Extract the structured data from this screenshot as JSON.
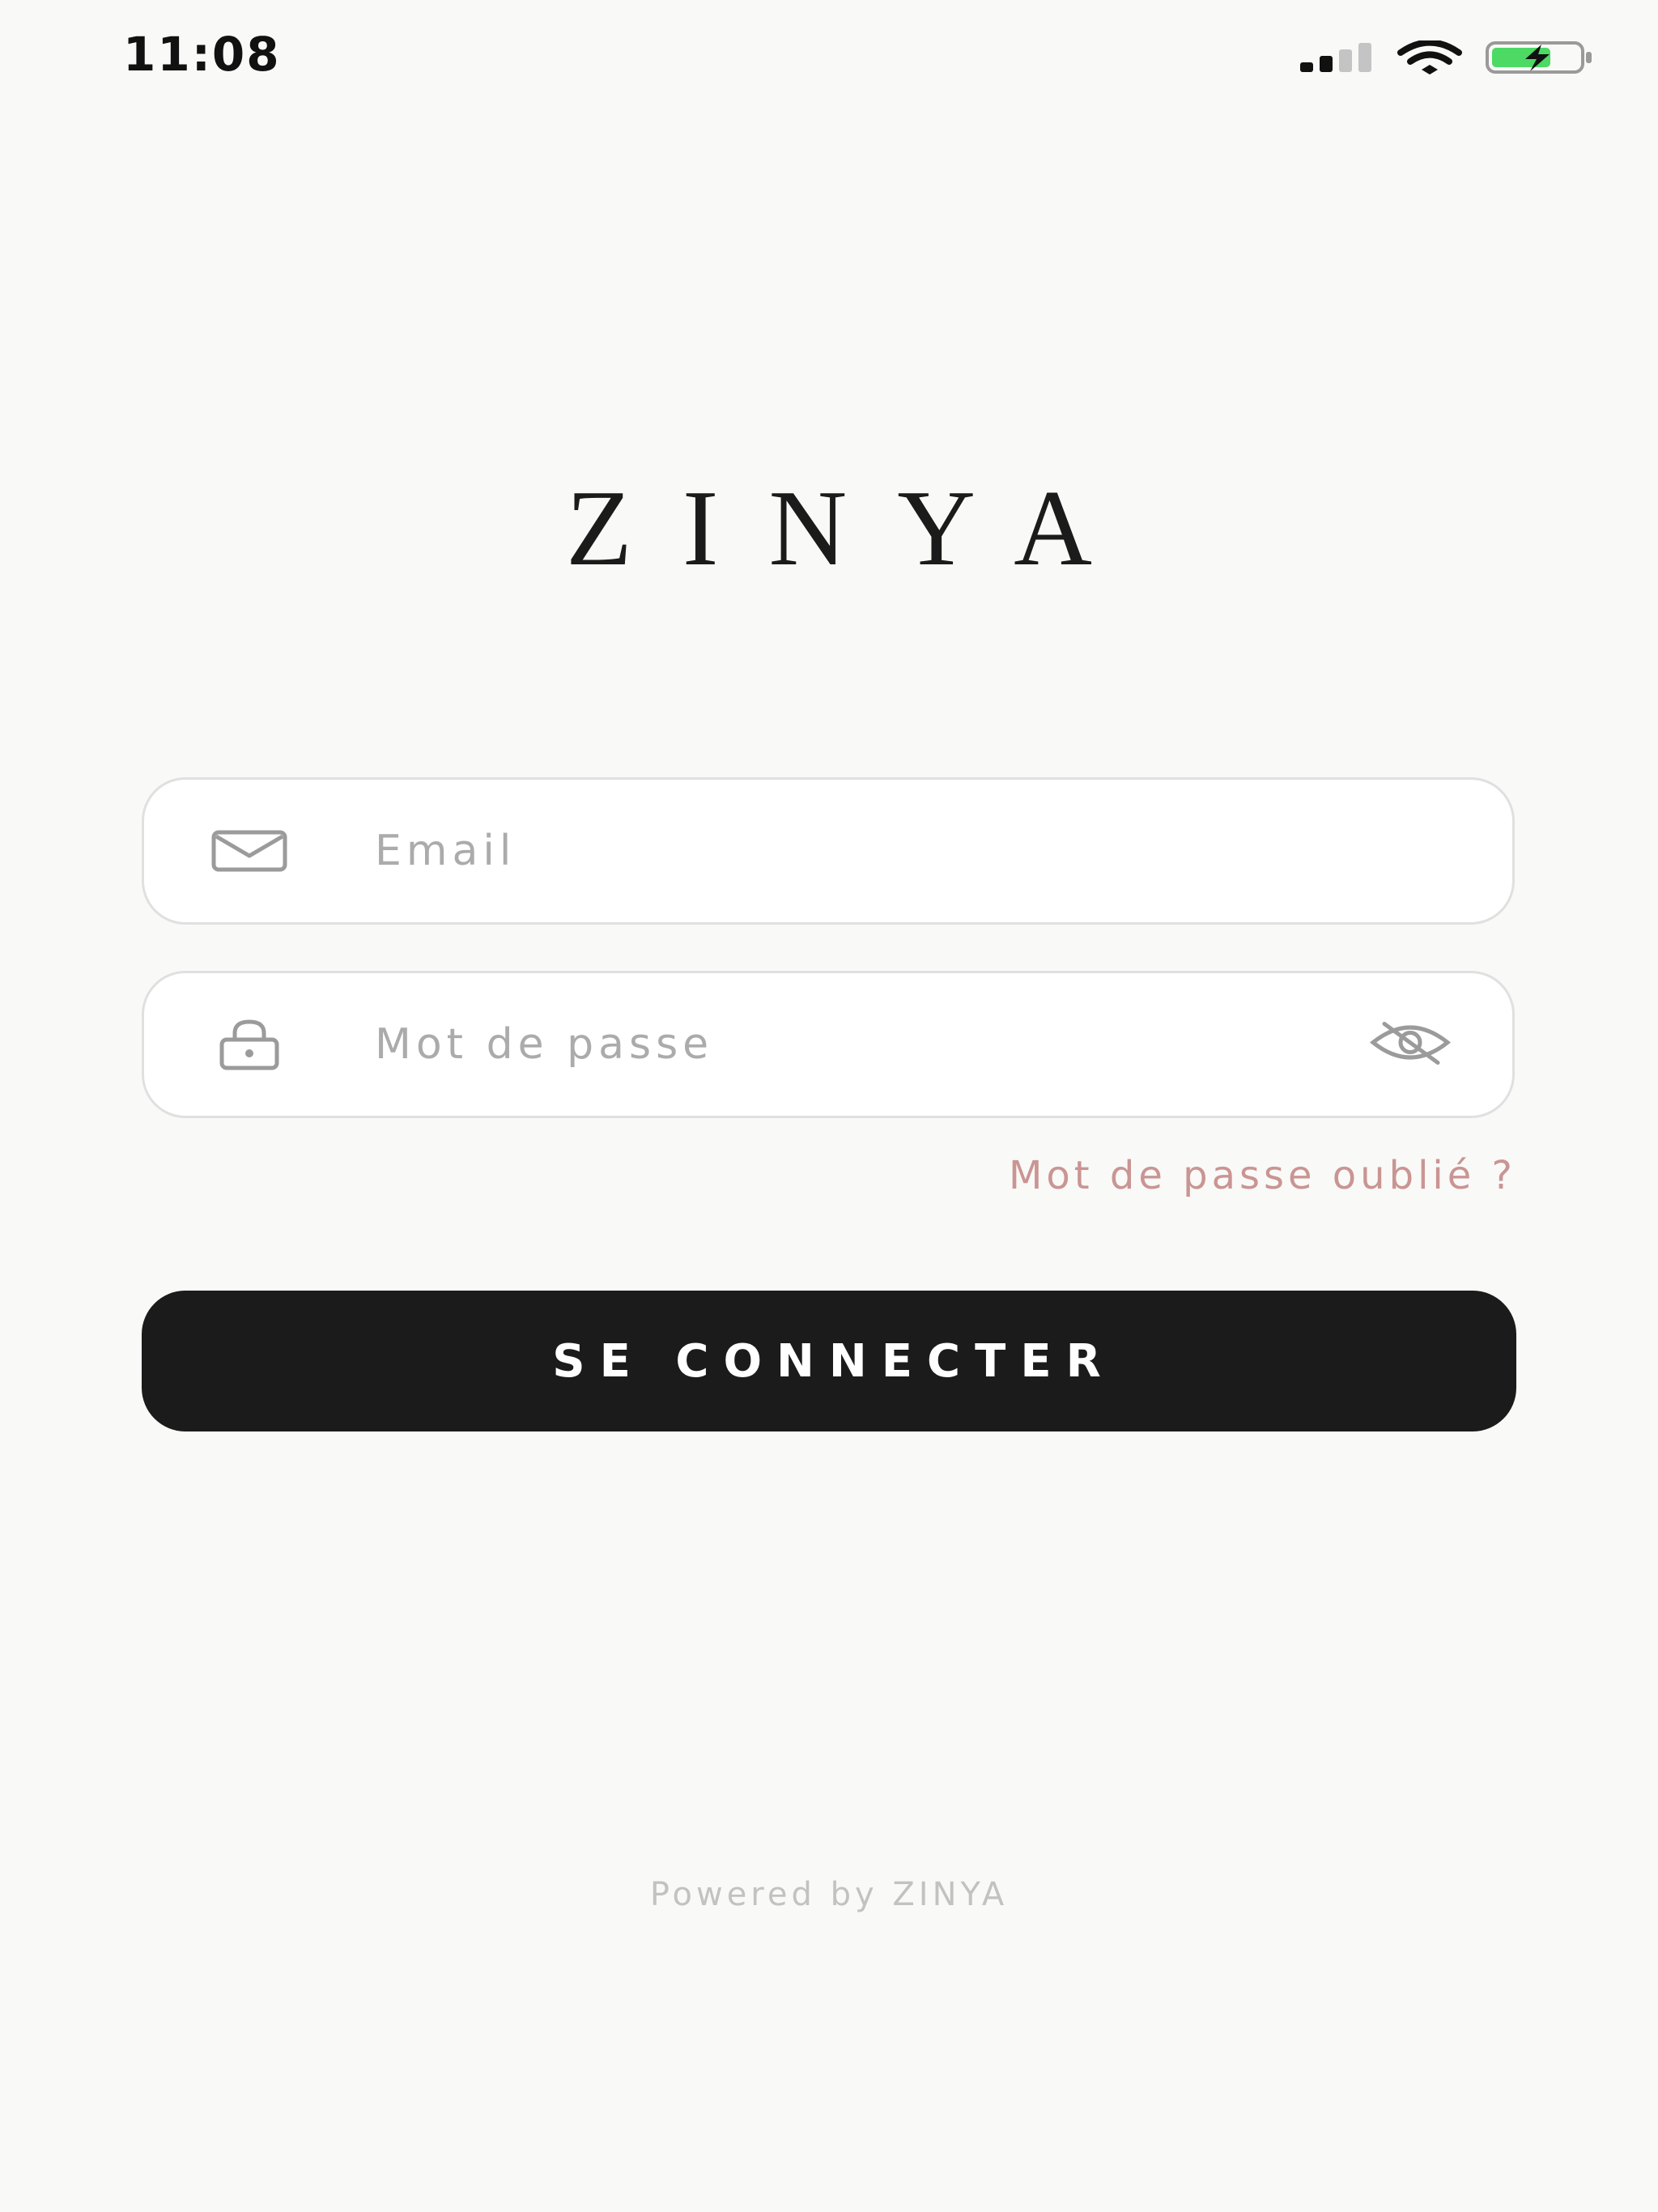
{
  "status_bar": {
    "time": "11:08",
    "icons": [
      "cellular-signal-icon",
      "wifi-icon",
      "battery-charging-icon"
    ],
    "battery_color": "#4cd964"
  },
  "brand": {
    "logo": "ZINYA"
  },
  "login_form": {
    "email": {
      "icon": "mail-icon",
      "value": "",
      "placeholder": "Email"
    },
    "password": {
      "icon": "lock-icon",
      "value": "",
      "placeholder": "Mot de passe",
      "visibility_icon": "eye-off-icon"
    },
    "forgot_password_label": "Mot de passe oublié ?",
    "submit_label": "SE CONNECTER"
  },
  "footer": {
    "powered_by": "Powered by ZINYA"
  },
  "colors": {
    "background": "#f9f9f7",
    "button": "#1b1b1b",
    "link": "#c99593",
    "placeholder": "#ababab"
  }
}
